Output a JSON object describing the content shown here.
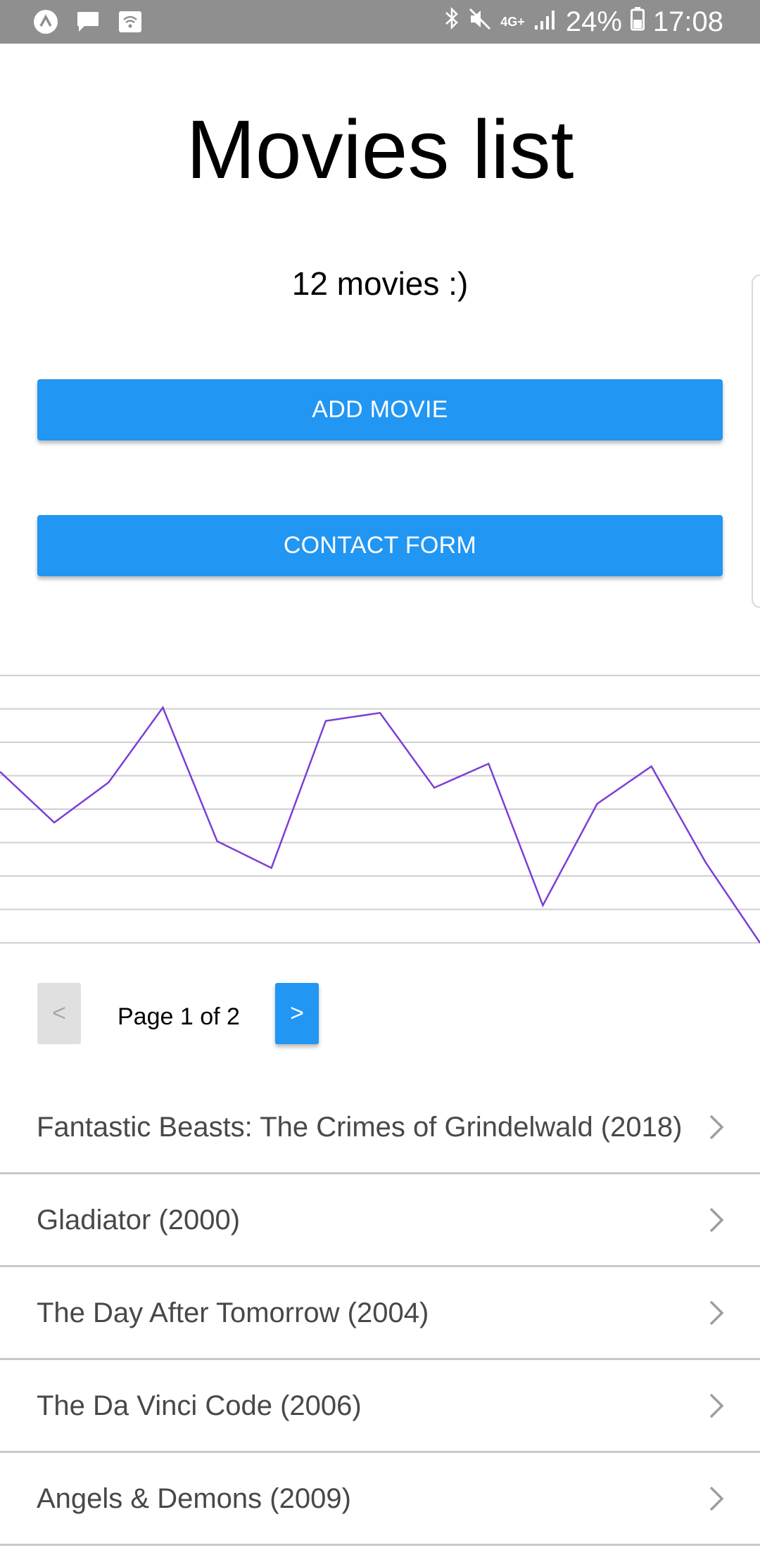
{
  "status_bar": {
    "network": "4G+",
    "battery": "24%",
    "time": "17:08",
    "icons": [
      "app-icon",
      "message-icon",
      "wifi-icon",
      "bluetooth-icon",
      "mute-icon",
      "signal-icon",
      "battery-icon"
    ]
  },
  "header": {
    "title": "Movies list",
    "count": "12 movies :)"
  },
  "buttons": {
    "add_movie": "ADD MOVIE",
    "contact_form": "CONTACT FORM"
  },
  "chart_data": {
    "type": "line",
    "title": "",
    "xlabel": "",
    "ylabel": "",
    "grid": true,
    "line_color": "#7b3fd6",
    "ylim": [
      0,
      10
    ],
    "x": [
      1,
      2,
      3,
      4,
      5,
      6,
      7,
      8,
      9,
      10,
      11,
      12,
      13,
      14,
      15
    ],
    "values": [
      6.4,
      4.5,
      6.0,
      8.8,
      3.8,
      2.8,
      8.3,
      8.6,
      5.8,
      6.7,
      1.4,
      5.2,
      6.6,
      3.0,
      0.0
    ]
  },
  "pagination": {
    "prev_label": "<",
    "page_text": "Page 1 of 2",
    "next_label": ">"
  },
  "movies": [
    {
      "title": "Fantastic Beasts: The Crimes of Grindelwald (2018)"
    },
    {
      "title": "Gladiator (2000)"
    },
    {
      "title": "The Day After Tomorrow (2004)"
    },
    {
      "title": "The Da Vinci Code (2006)"
    },
    {
      "title": "Angels & Demons (2009)"
    }
  ],
  "colors": {
    "accent": "#2196f3",
    "status_bar": "#8f8f8f",
    "chart_line": "#7b3fd6",
    "grid": "#cfcfcf"
  }
}
